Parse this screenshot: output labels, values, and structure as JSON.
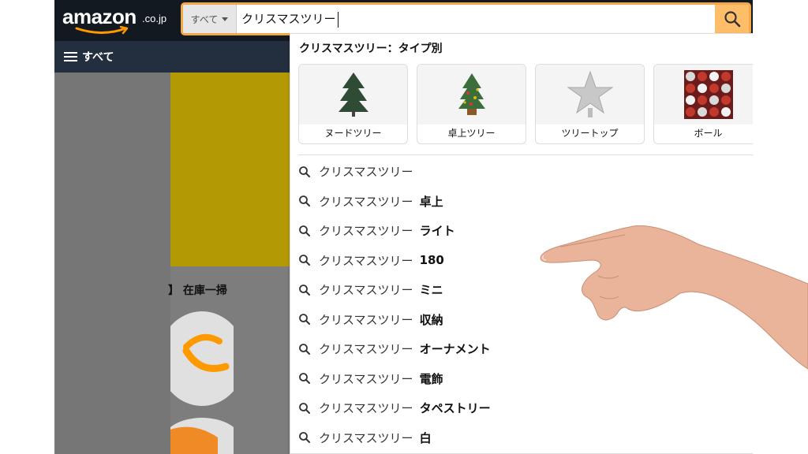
{
  "header": {
    "logo_text": "amazon",
    "logo_suffix": ".co.jp",
    "scope_label": "すべて",
    "search_query": "クリスマスツリー",
    "search_icon": "search-icon"
  },
  "nav": {
    "all_label": "すべて",
    "menu_icon": "hamburger-icon"
  },
  "background": {
    "peek_text": "】 在庫一掃"
  },
  "dropdown": {
    "heading": "クリスマスツリー：タイプ別",
    "cards": [
      {
        "label": "ヌードツリー",
        "icon": "nude-tree-icon"
      },
      {
        "label": "卓上ツリー",
        "icon": "tabletop-tree-icon"
      },
      {
        "label": "ツリートップ",
        "icon": "tree-topper-star-icon"
      },
      {
        "label": "ボール",
        "icon": "ornament-balls-icon"
      }
    ],
    "suggestions": [
      {
        "base": "クリスマスツリー",
        "suffix": ""
      },
      {
        "base": "クリスマスツリー",
        "suffix": "卓上"
      },
      {
        "base": "クリスマスツリー",
        "suffix": "ライト"
      },
      {
        "base": "クリスマスツリー",
        "suffix": "180"
      },
      {
        "base": "クリスマスツリー",
        "suffix": "ミニ"
      },
      {
        "base": "クリスマスツリー",
        "suffix": "収納"
      },
      {
        "base": "クリスマスツリー",
        "suffix": "オーナメント"
      },
      {
        "base": "クリスマスツリー",
        "suffix": "電飾"
      },
      {
        "base": "クリスマスツリー",
        "suffix": "タペストリー"
      },
      {
        "base": "クリスマスツリー",
        "suffix": "白"
      }
    ]
  },
  "colors": {
    "header_bg": "#131921",
    "nav_bg": "#232f3e",
    "search_button": "#febd69",
    "focus_border": "#f3a847",
    "banner": "#b39a05"
  }
}
